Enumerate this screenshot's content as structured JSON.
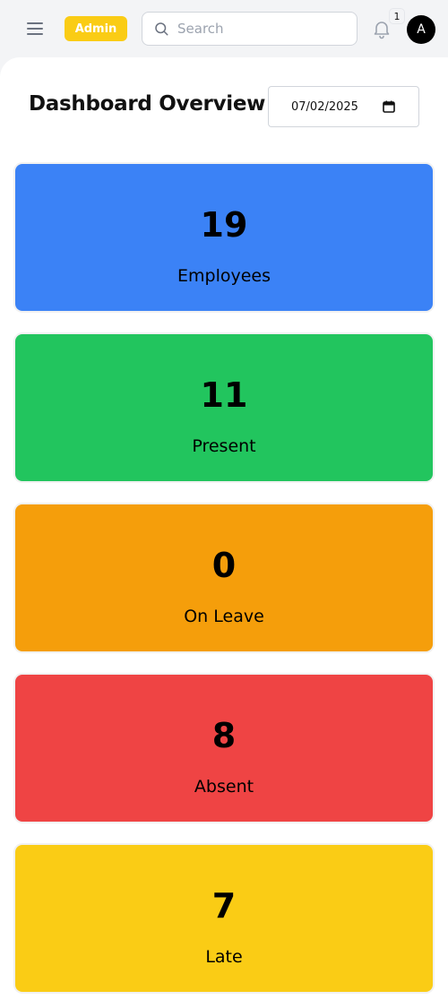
{
  "header": {
    "role_badge": "Admin",
    "search_placeholder": "Search",
    "notification_count": "1",
    "avatar_initial": "A"
  },
  "page": {
    "title": "Dashboard Overview",
    "date_value": "07/02/2025"
  },
  "stats": [
    {
      "value": "19",
      "label": "Employees",
      "color": "#3b82f6"
    },
    {
      "value": "11",
      "label": "Present",
      "color": "#22c55e"
    },
    {
      "value": "0",
      "label": "On Leave",
      "color": "#f59e0b"
    },
    {
      "value": "8",
      "label": "Absent",
      "color": "#ef4444"
    },
    {
      "value": "7",
      "label": "Late",
      "color": "#facc15"
    }
  ]
}
